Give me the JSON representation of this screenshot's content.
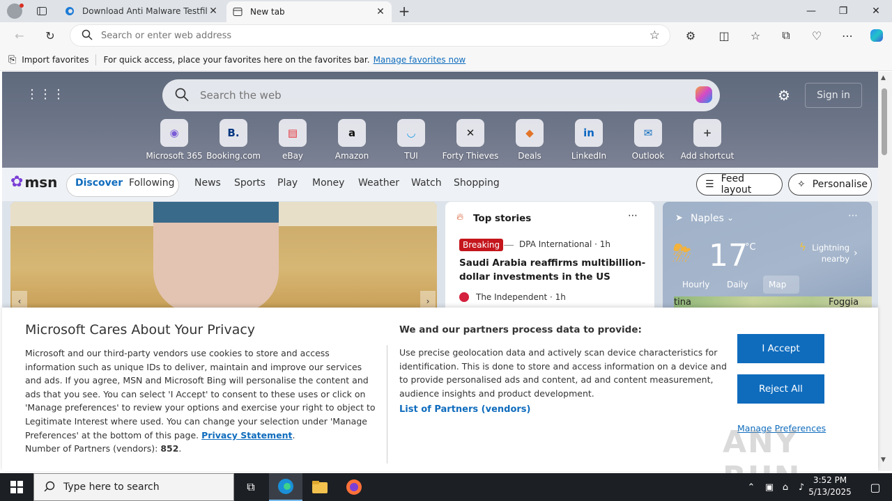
{
  "browser": {
    "tabs": [
      {
        "title": "Download Anti Malware Testfile -",
        "active": false
      },
      {
        "title": "New tab",
        "active": true
      }
    ],
    "address_placeholder": "Search or enter web address",
    "favorites_bar": {
      "import_label": "Import favorites",
      "hint": "For quick access, place your favorites here on the favorites bar.",
      "manage_link": "Manage favorites now"
    }
  },
  "newtab": {
    "search_placeholder": "Search the web",
    "sign_in": "Sign in",
    "shortcuts": [
      {
        "label": "Microsoft 365",
        "glyph": "◉",
        "color": "#7b5cd6"
      },
      {
        "label": "Booking.com",
        "glyph": "B.",
        "color": "#003580"
      },
      {
        "label": "eBay",
        "glyph": "▤",
        "color": "#e53238"
      },
      {
        "label": "Amazon",
        "glyph": "a",
        "color": "#111111"
      },
      {
        "label": "TUI",
        "glyph": "◡",
        "color": "#1a9be6"
      },
      {
        "label": "Forty Thieves",
        "glyph": "✕",
        "color": "#222222"
      },
      {
        "label": "Deals",
        "glyph": "◆",
        "color": "#e2742a"
      },
      {
        "label": "LinkedIn",
        "glyph": "in",
        "color": "#0a66c2"
      },
      {
        "label": "Outlook",
        "glyph": "✉",
        "color": "#0f6cbd"
      },
      {
        "label": "Add shortcut",
        "glyph": "+",
        "color": "#444444"
      }
    ],
    "msn": {
      "brand": "msn",
      "tabs": [
        "Discover",
        "Following"
      ],
      "nav": [
        "News",
        "Sports",
        "Play",
        "Money",
        "Weather",
        "Watch",
        "Shopping"
      ],
      "feed_layout": "Feed layout",
      "personalise": "Personalise"
    },
    "top_stories": {
      "heading": "Top stories",
      "badge": "Breaking",
      "source1": "DPA International · 1h",
      "headline1": "Saudi Arabia reaffirms multibillion-dollar investments in the US",
      "source2": "The Independent · 1h"
    },
    "weather": {
      "location": "Naples",
      "temp": "17",
      "unit": "°C",
      "alert": "Lightning nearby",
      "tabs": [
        "Hourly",
        "Daily",
        "Map"
      ],
      "map_labels": [
        "tina",
        "Foggia"
      ]
    }
  },
  "consent": {
    "title": "Microsoft Cares About Your Privacy",
    "body": "Microsoft and our third-party vendors use cookies to store and access information such as unique IDs to deliver, maintain and improve our services and ads. If you agree, MSN and Microsoft Bing will personalise the content and ads that you see. You can select 'I Accept' to consent to these uses or click on 'Manage preferences' to review your options and exercise your right to object to Legitimate Interest where used.  You can change your selection under 'Manage Preferences' at the bottom of this page.",
    "privacy_link": "Privacy Statement",
    "partners_label": "Number of Partners (vendors):",
    "partners_count": "852",
    "right_heading": "We and our partners process data to provide:",
    "right_body": "Use precise geolocation data and actively scan device characteristics for identification. This is done to store and access information on a device and to provide personalised ads and content, ad and content measurement, audience insights and product development.",
    "partners_link": "List of Partners (vendors)",
    "accept": "I Accept",
    "reject": "Reject All",
    "manage": "Manage Preferences"
  },
  "taskbar": {
    "search_placeholder": "Type here to search",
    "time": "3:52 PM",
    "date": "5/13/2025"
  },
  "watermark": "ANY RUN"
}
